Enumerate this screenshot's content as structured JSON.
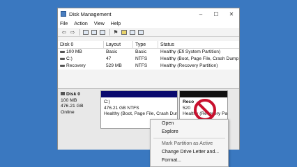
{
  "window": {
    "title": "Disk Management",
    "minimize": "–",
    "maximize": "☐",
    "close": "✕"
  },
  "menu": [
    "File",
    "Action",
    "View",
    "Help"
  ],
  "volumes": {
    "columns": [
      "Disk 0",
      "Layout",
      "Type",
      "Status"
    ],
    "rows": [
      {
        "name": "100 MB",
        "layout": "Basic",
        "type": "Basic",
        "status": "Healthy (Efi System Partition)"
      },
      {
        "name": "C:)",
        "layout": "47",
        "type": "NTFS",
        "status": "Healthy (Boot, Page File, Crash Dump"
      },
      {
        "name": "Recovery",
        "layout": "529 MB",
        "type": "NTFS",
        "status": "Healthy (Recovery Partition)"
      }
    ]
  },
  "disk": {
    "name": "Disk 0",
    "size1": "100 MB",
    "size2": "476.21 GB",
    "state": "Online"
  },
  "partitions": {
    "main": {
      "label": "C:)",
      "size": "476.21 GB NTFS",
      "status": "Healthy (Boot, Page File, Crash Dum"
    },
    "recovery": {
      "label": "Reco",
      "size": "520",
      "status": "Healthy (Recovery Pa"
    }
  },
  "context_menu": {
    "items": [
      "Open",
      "Explore",
      "Mark Partition as Active",
      "Change Drive Letter and...",
      "Format..."
    ]
  },
  "colors": {
    "desktop": "#3a78c0",
    "partition_bar": "#0a0a6e",
    "no_sign": "#c8102e"
  }
}
